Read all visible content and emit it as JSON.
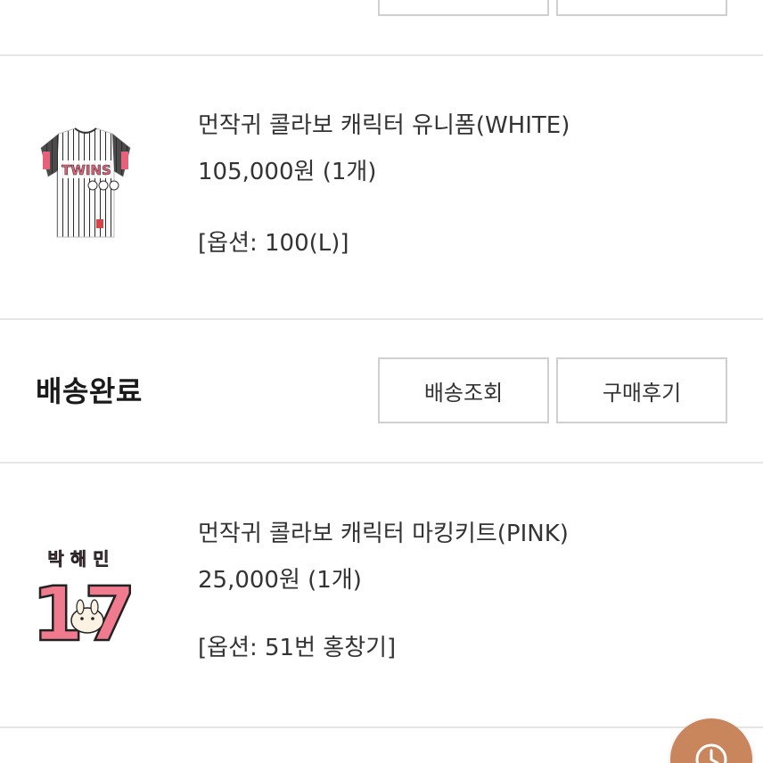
{
  "top_actions": {
    "track_label": "",
    "review_label": ""
  },
  "orders": [
    {
      "item": {
        "name": "먼작귀 콜라보 캐릭터 유니폼(WHITE)",
        "price": "105,000원 (1개)",
        "option": "[옵션: 100(L)]",
        "thumbnail_text": "TWINS"
      }
    },
    {
      "status": "배송완료",
      "track_label": "배송조회",
      "review_label": "구매후기",
      "item": {
        "name": "먼작귀 콜라보 캐릭터 마킹키트(PINK)",
        "price": "25,000원 (1개)",
        "option": "[옵션: 51번 홍창기]",
        "thumbnail_name": "박 해 민",
        "thumbnail_number": "17"
      }
    }
  ],
  "colors": {
    "accent": "#c9865d",
    "border": "#cfcfcf",
    "jersey_pink": "#e8617a"
  },
  "icons": {
    "fab": "clock-icon"
  }
}
